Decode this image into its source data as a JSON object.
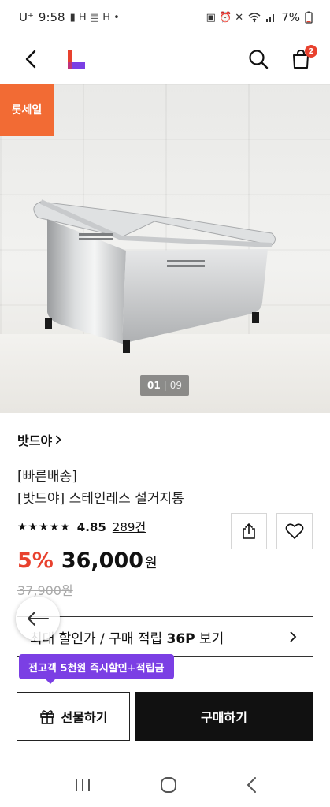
{
  "status_bar": {
    "carrier": "U⁺",
    "time": "9:58",
    "notif_icons": "▮ H ▤ H •",
    "system_icons": "▣ ⏰ ✕",
    "battery": "7%"
  },
  "nav": {
    "cart_count": "2"
  },
  "product_image": {
    "sale_badge": "롯세일",
    "pager_current": "01",
    "pager_separator": "|",
    "pager_total": "09"
  },
  "product": {
    "brand": "밧드야",
    "badge": "[빠른배송]",
    "name": "[밧드야] 스테인레스 설거지통",
    "stars": "★★★★★",
    "rating": "4.85",
    "review_count": "289건",
    "discount": "5%",
    "price": "36,000",
    "currency": "원",
    "original_price": "37,900원"
  },
  "max_discount": {
    "label_prefix": "최대 할인가 / 구매 적립 ",
    "points": "36P",
    "label_suffix": " 보기"
  },
  "promo": {
    "tooltip": "전고객 5천원 즉시할인+적립금"
  },
  "bottom_bar": {
    "gift_label": "선물하기",
    "buy_label": "구매하기"
  },
  "colors": {
    "accent_red": "#e8412e",
    "sale_orange": "#f26b34",
    "promo_purple": "#7b3fe4"
  },
  "icons": [
    "back-arrow-icon",
    "lotte-logo-icon",
    "search-icon",
    "cart-icon",
    "share-icon",
    "heart-icon",
    "chevron-right-icon",
    "gift-icon",
    "recent-apps-icon",
    "home-icon",
    "back-icon"
  ]
}
